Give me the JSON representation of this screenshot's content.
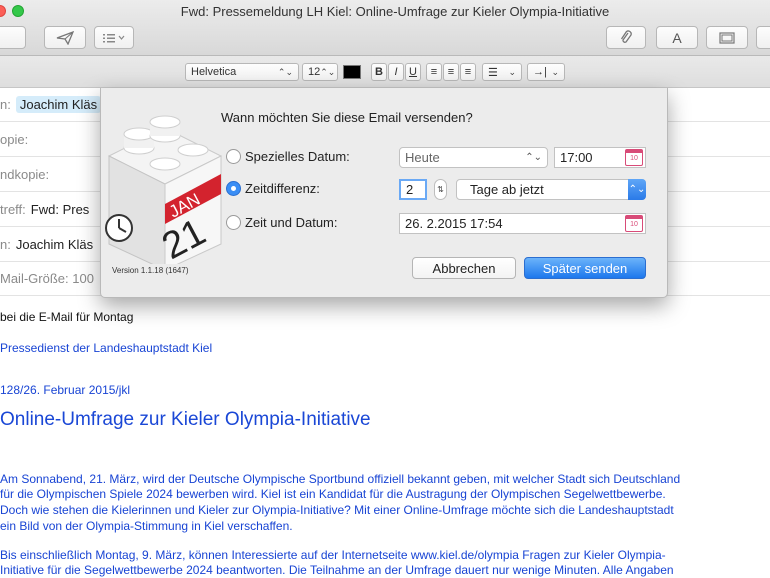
{
  "window": {
    "title": "Fwd: Pressemeldung LH Kiel: Online-Umfrage zur Kieler Olympia-Initiative"
  },
  "toolbar": {
    "font_button_label": "A"
  },
  "format_bar": {
    "font": "Helvetica",
    "size": "12",
    "bold": "B",
    "italic": "I",
    "underline": "U"
  },
  "header": {
    "to_label": "n:",
    "to_value": "Joachim Kläs",
    "cc_label": "opie:",
    "bcc_label": "ndkopie:",
    "subject_label": "treff:",
    "subject_value": "Fwd: Pres",
    "from_label": "n:",
    "from_value": "Joachim Kläs",
    "size_label": "Mail-Größe: 100"
  },
  "dialog": {
    "question": "Wann möchten Sie diese Email versenden?",
    "option_special_date": "Spezielles Datum:",
    "option_time_diff": "Zeitdifferenz:",
    "option_time_and_date": "Zeit und Datum:",
    "special_date_value": "Heute",
    "special_time_value": "17:00",
    "time_diff_amount": "2",
    "time_diff_unit": "Tage ab jetzt",
    "datetime_value": "26.  2.2015 17:54",
    "version": "Version 1.1.18 (1647)",
    "icon_month": "JAN",
    "icon_day": "21",
    "cancel_label": "Abbrechen",
    "send_later_label": "Später senden",
    "selected_option": "time_diff"
  },
  "message": {
    "line1": "bei die E-Mail für Montag",
    "line2": "Pressedienst der Landeshauptstadt Kiel",
    "line3": "128/26. Februar 2015/jkl",
    "headline": "Online-Umfrage zur Kieler Olympia-Initiative",
    "para1_l1": "Am Sonnabend, 21. März, wird der Deutsche Olympische Sportbund offiziell bekannt geben, mit welcher Stadt sich Deutschland",
    "para1_l2": "für die Olympischen Spiele 2024 bewerben wird. Kiel ist ein Kandidat für die Austragung der Olympischen Segelwettbewerbe.",
    "para1_l3": "Doch wie stehen die Kielerinnen und Kieler zur Olympia-Initiative? Mit einer Online-Umfrage möchte sich die Landeshauptstadt",
    "para1_l4": "ein Bild von der Olympia-Stimmung in Kiel verschaffen.",
    "para2_l1": "Bis einschließlich Montag, 9. März, können Interessierte auf der Internetseite www.kiel.de/olympia Fragen zur Kieler Olympia-",
    "para2_l2": "Initiative für die Segelwettbewerbe 2024 beantworten. Die Teilnahme an der Umfrage dauert nur wenige Minuten. Alle Angaben"
  }
}
